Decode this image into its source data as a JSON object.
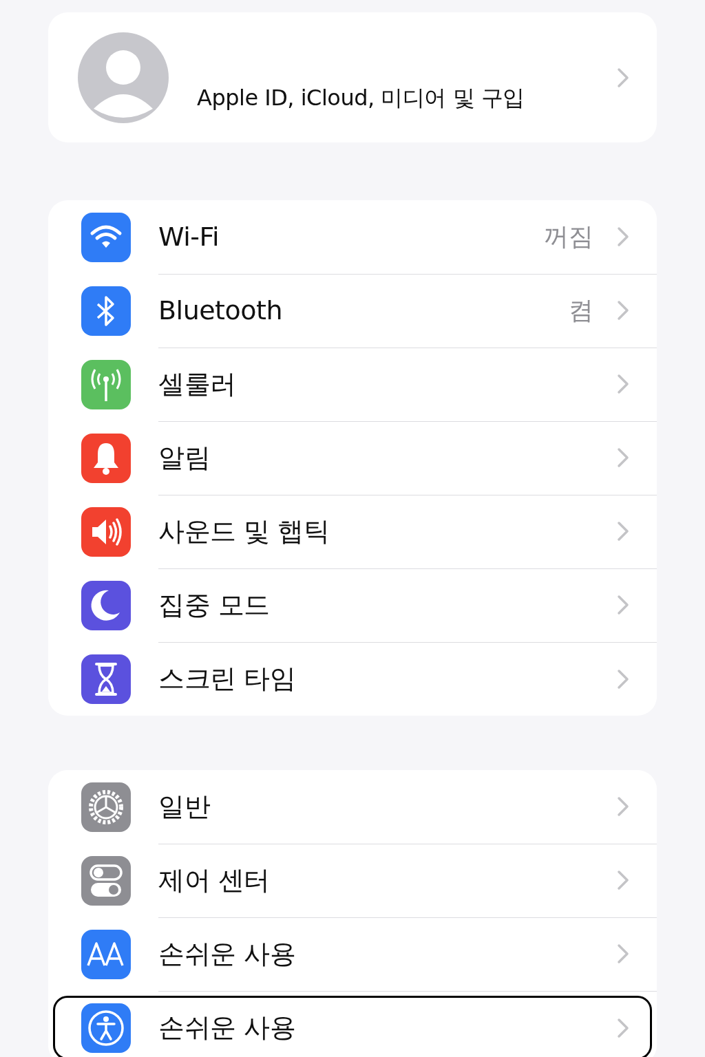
{
  "profile": {
    "label": "Apple ID, iCloud, 미디어 및 구입"
  },
  "groups": [
    {
      "items": [
        {
          "label": "Wi-Fi",
          "value": "꺼짐",
          "focused": false
        },
        {
          "label": "Bluetooth",
          "value": "켬",
          "focused": false
        },
        {
          "label": "셀룰러",
          "focused": false
        },
        {
          "label": "알림",
          "focused": false
        },
        {
          "label": "사운드 및 햅틱",
          "focused": false
        },
        {
          "label": "집중 모드",
          "focused": false
        },
        {
          "label": "스크린 타임",
          "focused": false
        }
      ]
    },
    {
      "items": [
        {
          "label": "일반",
          "focused": false
        },
        {
          "label": "제어 센터",
          "focused": false
        },
        {
          "label": "손쉬운 사용",
          "focused": false
        },
        {
          "label": "손쉬운 사용",
          "focused": true
        }
      ]
    }
  ]
}
